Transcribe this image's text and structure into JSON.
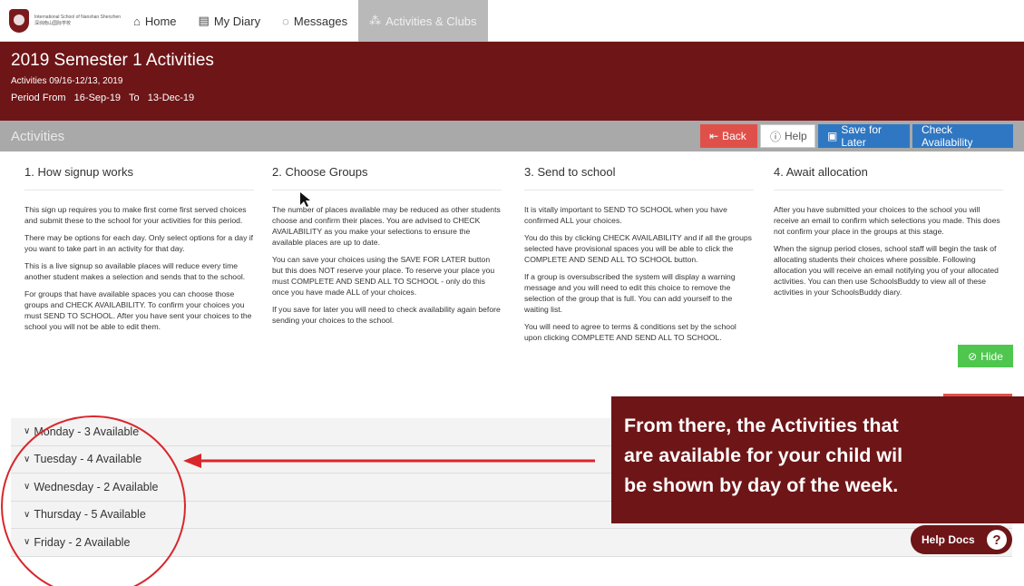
{
  "nav": {
    "school_name": "International School of Nanshan Shenzhen",
    "school_name_cn": "深圳南山国际学校",
    "items": [
      {
        "label": "Home",
        "icon": "home-icon"
      },
      {
        "label": "My Diary",
        "icon": "calendar-icon"
      },
      {
        "label": "Messages",
        "icon": "chat-icon"
      },
      {
        "label": "Activities & Clubs",
        "icon": "activities-icon",
        "active": true
      }
    ]
  },
  "header": {
    "title": "2019 Semester 1 Activities",
    "subtitle": "Activities 09/16-12/13, 2019",
    "period": "Period From   16-Sep-19   To   13-Dec-19"
  },
  "toolbar": {
    "title": "Activities",
    "back_label": "Back",
    "help_label": "Help",
    "save_label": "Save for Later",
    "check_label": "Check Availability"
  },
  "steps": [
    {
      "title": "1. How signup works",
      "paragraphs": [
        "This sign up requires you to make first come first served choices and submit these to the school for your activities for this period.",
        "There may be options for each day. Only select options for a day if you want to take part in an activity for that day.",
        "This is a live signup so available places will reduce every time another student makes a selection and sends that to the school.",
        "For groups that have available spaces you can choose those groups and CHECK AVAILABILITY. To confirm your choices you must SEND TO SCHOOL. After you have sent your choices to the school you will not be able to edit them."
      ]
    },
    {
      "title": "2. Choose Groups",
      "paragraphs": [
        "The number of places available may be reduced as other students choose and confirm their places. You are advised to CHECK AVAILABILITY as you make your selections to ensure the available places are up to date.",
        "You can save your choices using the SAVE FOR LATER button but this does NOT reserve your place. To reserve your place you must COMPLETE AND SEND ALL TO SCHOOL - only do this once you have made ALL of your choices.",
        "If you save for later you will need to check availability again before sending your choices to the school."
      ]
    },
    {
      "title": "3. Send to school",
      "paragraphs": [
        "It is vitally important to SEND TO SCHOOL when you have confirmed ALL your choices.",
        "You do this by clicking CHECK AVAILABILITY and if all the groups selected have provisional spaces you will be able to click the COMPLETE AND SEND ALL TO SCHOOL button.",
        "If a group is oversubscribed the system will display a warning message and you will need to edit this choice to remove the selection of the group that is full. You can add yourself to the waiting list.",
        "You will need to agree to terms & conditions set by the school upon clicking COMPLETE AND SEND ALL TO SCHOOL."
      ]
    },
    {
      "title": "4. Await allocation",
      "paragraphs": [
        "After you have submitted your choices to the school you will receive an email to confirm which selections you made. This does not confirm your place in the groups at this stage.",
        "When the signup period closes, school staff will begin the task of allocating students their choices where possible. Following allocation you will receive an email notifying you of your allocated activities. You can then use SchoolsBuddy to view all of these activities in your SchoolsBuddy diary."
      ]
    }
  ],
  "hide_label": "Hide",
  "days": [
    "Monday - 3 Available",
    "Tuesday - 4 Available",
    "Wednesday - 2 Available",
    "Thursday - 5 Available",
    "Friday - 2 Available"
  ],
  "callout": {
    "line1": "From there, the Activities that",
    "line2": "are available for your child wil",
    "line3": "be shown by day of the week."
  },
  "help_docs": {
    "label": "Help Docs",
    "icon": "question-icon"
  },
  "colors": {
    "brand": "#6e1517",
    "primary": "#2f77c2",
    "danger": "#e0504a",
    "success": "#4fc64e",
    "annotation": "#d9262b"
  }
}
